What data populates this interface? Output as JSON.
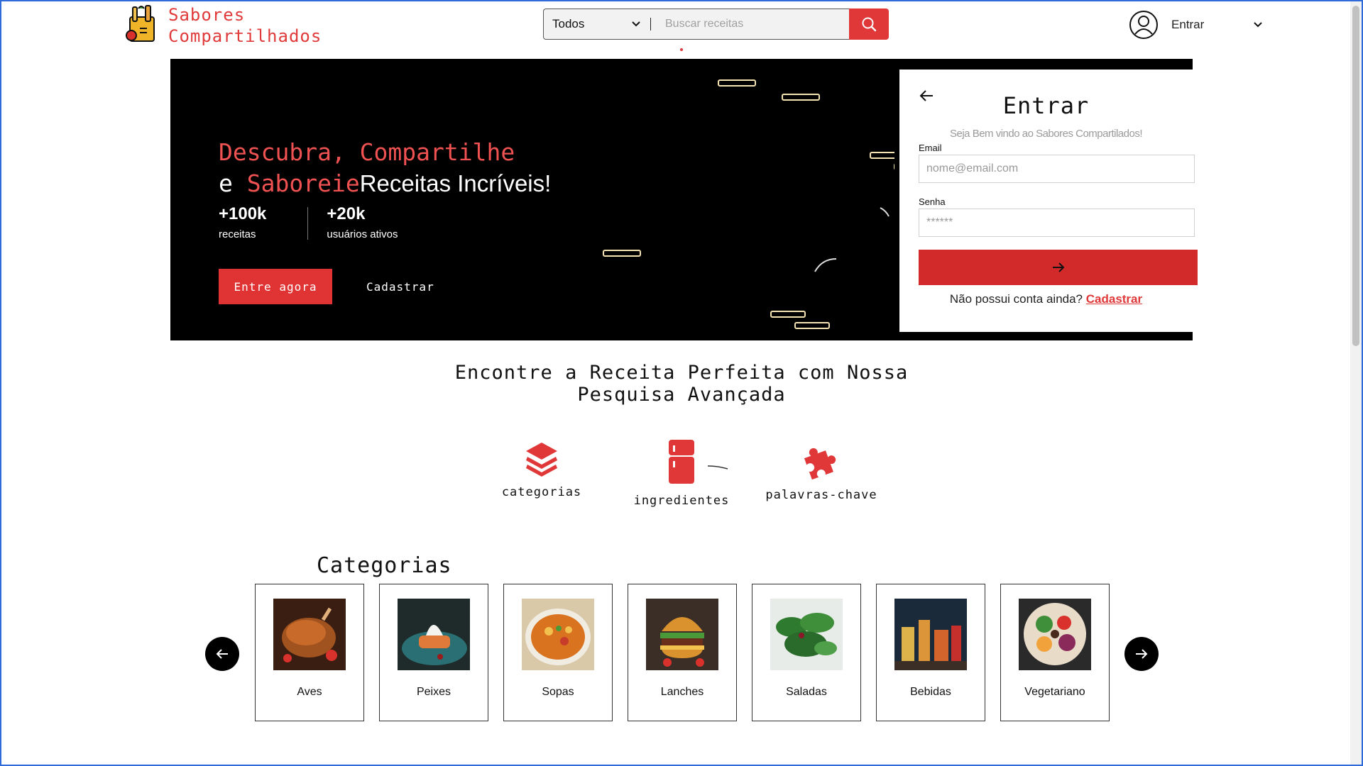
{
  "brand": {
    "line1": "Sabores",
    "line2": "Compartilhados",
    "color": "#e03a3a"
  },
  "search": {
    "category_selected": "Todos",
    "placeholder": "Buscar receitas"
  },
  "user": {
    "label": "Entrar"
  },
  "hero": {
    "title_red_1": "Descubra, Compartilhe",
    "title_white_e": "e",
    "title_red_2": "Saboreie",
    "title_white_2": "Receitas Incríveis!",
    "stats": [
      {
        "value": "+100k",
        "label": "receitas"
      },
      {
        "value": "+20k",
        "label": "usuários ativos"
      }
    ],
    "primary_button": "Entre agora",
    "secondary_button": "Cadastrar"
  },
  "login": {
    "title": "Entrar",
    "subtitle": "Seja Bem vindo ao Sabores Compartilados!",
    "email_label": "Email",
    "email_placeholder": "nome@email.com",
    "password_label": "Senha",
    "password_placeholder": "******",
    "no_account": "Não possui conta ainda?",
    "register_link": "Cadastrar"
  },
  "advanced_search": {
    "title_line1": "Encontre a Receita Perfeita com Nossa",
    "title_line2": "Pesquisa Avançada",
    "features": [
      {
        "label": "categorias",
        "icon": "layers-icon"
      },
      {
        "label": "ingredientes",
        "icon": "fridge-icon"
      },
      {
        "label": "palavras-chave",
        "icon": "puzzle-icon"
      }
    ]
  },
  "categories": {
    "title": "Categorias",
    "items": [
      {
        "label": "Aves"
      },
      {
        "label": "Peixes"
      },
      {
        "label": "Sopas"
      },
      {
        "label": "Lanches"
      },
      {
        "label": "Saladas"
      },
      {
        "label": "Bebidas"
      },
      {
        "label": "Vegetariano"
      }
    ]
  },
  "colors": {
    "accent": "#e03838",
    "hero_bg": "#000000",
    "login_button": "#d22a2a"
  }
}
